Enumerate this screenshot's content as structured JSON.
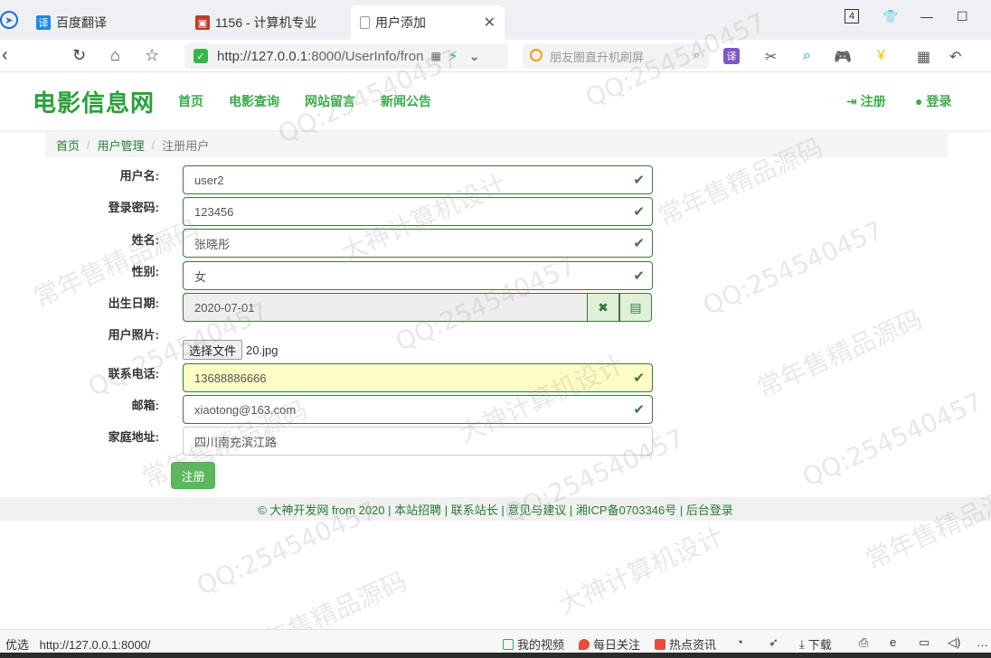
{
  "browser": {
    "tabs": [
      {
        "label": "百度翻译",
        "favicon": "译"
      },
      {
        "label": "1156 - 计算机专业",
        "favicon": "▣"
      },
      {
        "label": "用户添加",
        "favicon": "▭"
      }
    ],
    "tab_counter": "4",
    "url": "http://127.0.0.1:8000/UserInfo/fron",
    "url_host": "http://127.0.0.1",
    "url_path": ":8000/UserInfo/fron",
    "search_placeholder": "朋友圈直升机刷屏",
    "colors": {
      "accent": "#3caa4a",
      "url_shield": "#3bb54a"
    }
  },
  "site": {
    "logo": "电影信息网",
    "nav": [
      "首页",
      "电影查询",
      "网站留言",
      "新闻公告"
    ],
    "auth": {
      "register": "注册",
      "login": "登录"
    }
  },
  "breadcrumb": {
    "home": "首页",
    "section": "用户管理",
    "current": "注册用户",
    "separator": "/"
  },
  "form": {
    "fields": [
      {
        "label": "用户名:",
        "value": "user2"
      },
      {
        "label": "登录密码:",
        "value": "123456"
      },
      {
        "label": "姓名:",
        "value": "张晓彤"
      },
      {
        "label": "性别:",
        "value": "女"
      },
      {
        "label": "出生日期:",
        "value": "2020-07-01"
      },
      {
        "label": "用户照片:",
        "value": "20.jpg"
      },
      {
        "label": "联系电话:",
        "value": "13688886666"
      },
      {
        "label": "邮箱:",
        "value": "xiaotong@163.com"
      },
      {
        "label": "家庭地址:",
        "value": "四川南充滨江路"
      }
    ],
    "file_button": "选择文件",
    "submit": "注册",
    "colors": {
      "valid_border": "#3c763d",
      "submit_bg": "#5cb85c",
      "autofill_bg": "#fcfcc4"
    }
  },
  "footer": {
    "text": "© 大神开发网 from 2020 | 本站招聘 | 联系站长 | 意见与建议 | 湘ICP备0703346号 | 后台登录"
  },
  "statusbar": {
    "url": "http://127.0.0.1:8000/",
    "prefix": "优选",
    "items": [
      "我的视频",
      "每日关注",
      "热点资讯",
      "下载"
    ]
  },
  "watermarks": [
    "QQ:254540457",
    "常年售精品源码",
    "大神计算机设计"
  ]
}
